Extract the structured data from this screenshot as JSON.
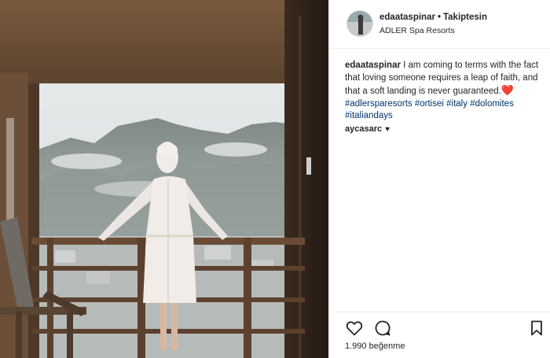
{
  "post": {
    "username": "edaataspinar",
    "separator": "•",
    "follow_status": "Takiptesin",
    "location": "ADLER Spa Resorts"
  },
  "caption": {
    "username": "edaataspinar",
    "text": " I am coming to terms with the fact that loving someone requires a leap of faith, and that a soft landing is never guaranteed.",
    "emoji": "❤️",
    "hashtags": [
      "#adlersparesorts",
      "#ortisei",
      "#italy",
      "#dolomites",
      "#italiandays"
    ]
  },
  "comments": [
    {
      "username": "aycasarc",
      "text": "♥"
    }
  ],
  "actions": {
    "like_icon": "heart-outline-icon",
    "comment_icon": "comment-bubble-icon",
    "save_icon": "bookmark-icon"
  },
  "likes": {
    "label": "1.990 beğenme"
  },
  "colors": {
    "text": "#262626",
    "hashtag": "#003569",
    "border": "#efefef"
  }
}
